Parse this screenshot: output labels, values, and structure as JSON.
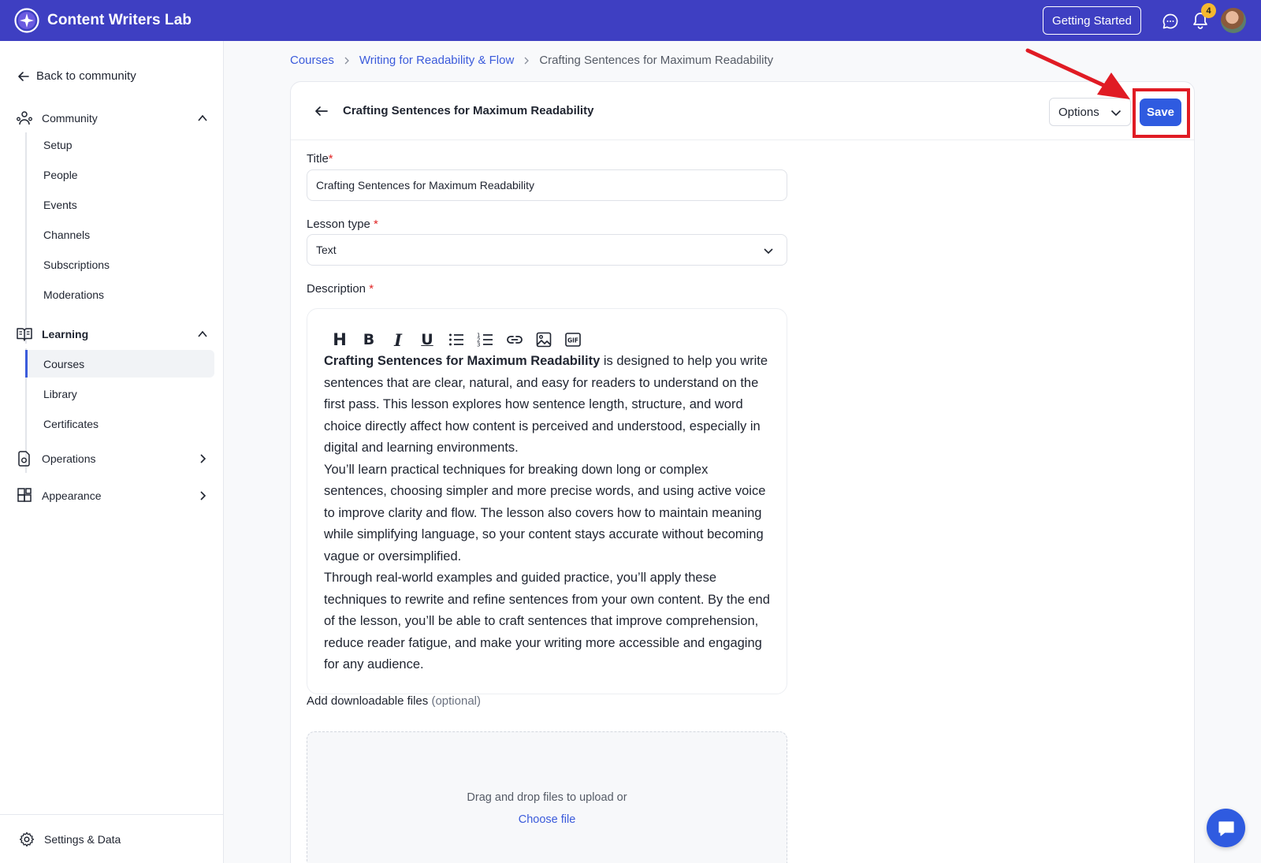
{
  "app": {
    "name": "Content Writers Lab",
    "getting_started": "Getting Started",
    "notification_count": "4",
    "brand_color": "#3e3fc2"
  },
  "sidebar": {
    "back_label": "Back to community",
    "community": {
      "label": "Community",
      "items": [
        "Setup",
        "People",
        "Events",
        "Channels",
        "Subscriptions",
        "Moderations"
      ]
    },
    "learning": {
      "label": "Learning",
      "items": [
        "Courses",
        "Library",
        "Certificates"
      ],
      "active": "Courses"
    },
    "operations": {
      "label": "Operations"
    },
    "appearance": {
      "label": "Appearance"
    },
    "settings_label": "Settings & Data"
  },
  "breadcrumb": [
    "Courses",
    "Writing for Readability & Flow",
    "Crafting Sentences for Maximum Readability"
  ],
  "lesson": {
    "header_title": "Crafting Sentences for Maximum Readability",
    "options_label": "Options",
    "save_label": "Save",
    "title_label": "Title",
    "title_value": "Crafting Sentences for Maximum Readability",
    "type_label": "Lesson type",
    "type_value": "Text",
    "description_label": "Description",
    "description": {
      "bold_lead": "Crafting Sentences for Maximum Readability",
      "p1_rest": " is designed to help you write sentences that are clear, natural, and easy for readers to understand on the first pass. This lesson explores how sentence length, structure, and word choice directly affect how content is perceived and understood, especially in digital and learning environments.",
      "p2": "You’ll learn practical techniques for breaking down long or complex sentences, choosing simpler and more precise words, and using active voice to improve clarity and flow. The lesson also covers how to maintain meaning while simplifying language, so your content stays accurate without becoming vague or oversimplified.",
      "p3": "Through real-world examples and guided practice, you’ll apply these techniques to rewrite and refine sentences from your own content. By the end of the lesson, you’ll be able to craft sentences that improve comprehension, reduce reader fatigue, and make your writing more accessible and engaging for any audience."
    },
    "files_label": "Add downloadable files",
    "files_optional": "(optional)",
    "drop_text": "Drag and drop files to upload or",
    "choose_file": "Choose file"
  },
  "toolbar": {
    "heading": "H",
    "bold": "B",
    "italic": "I",
    "underline": "U",
    "icons": [
      "bullet-list-icon",
      "numbered-list-icon",
      "link-icon",
      "image-icon",
      "gif-icon"
    ]
  },
  "colors": {
    "accent": "#2f5be0",
    "highlight": "#e01b24",
    "required": "#e02424"
  }
}
